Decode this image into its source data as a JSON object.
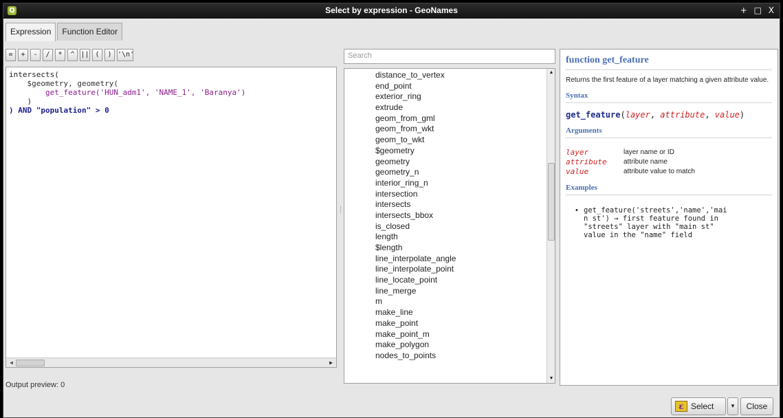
{
  "window": {
    "title": "Select by expression - GeoNames",
    "app_icon": "Q",
    "controls": [
      "+",
      "□",
      "X"
    ]
  },
  "tabs": [
    {
      "label": "Expression",
      "active": true
    },
    {
      "label": "Function Editor",
      "active": false
    }
  ],
  "operators": [
    "=",
    "+",
    "-",
    "/",
    "*",
    "^",
    "||",
    "(",
    ")",
    "'\\n'"
  ],
  "editor": {
    "lines": [
      "intersects(",
      "    $geometry, geometry(",
      "        get_feature('HUN_adm1', 'NAME_1', 'Baranya')",
      "    )",
      ") AND \"population\" > 0"
    ]
  },
  "output_preview": "Output preview:  0",
  "search": {
    "placeholder": "Search"
  },
  "functions": [
    "distance_to_vertex",
    "end_point",
    "exterior_ring",
    "extrude",
    "geom_from_gml",
    "geom_from_wkt",
    "geom_to_wkt",
    "$geometry",
    "geometry",
    "geometry_n",
    "interior_ring_n",
    "intersection",
    "intersects",
    "intersects_bbox",
    "is_closed",
    "length",
    "$length",
    "line_interpolate_angle",
    "line_interpolate_point",
    "line_locate_point",
    "line_merge",
    "m",
    "make_line",
    "make_point",
    "make_point_m",
    "make_polygon",
    "nodes_to_points"
  ],
  "help": {
    "title": "function get_feature",
    "description": "Returns the first feature of a layer matching a given attribute value.",
    "syntax_heading": "Syntax",
    "syntax_fn": "get_feature",
    "syntax_args": [
      "layer",
      "attribute",
      "value"
    ],
    "arguments_heading": "Arguments",
    "arguments": [
      {
        "name": "layer",
        "desc": "layer name or ID"
      },
      {
        "name": "attribute",
        "desc": "attribute name"
      },
      {
        "name": "value",
        "desc": "attribute value to match"
      }
    ],
    "examples_heading": "Examples",
    "example": "get_feature('streets','name','mai\nn st') → first feature found in\n\"streets\" layer with \"main st\"\nvalue in the \"name\" field"
  },
  "buttons": {
    "select": "Select",
    "close": "Close"
  }
}
